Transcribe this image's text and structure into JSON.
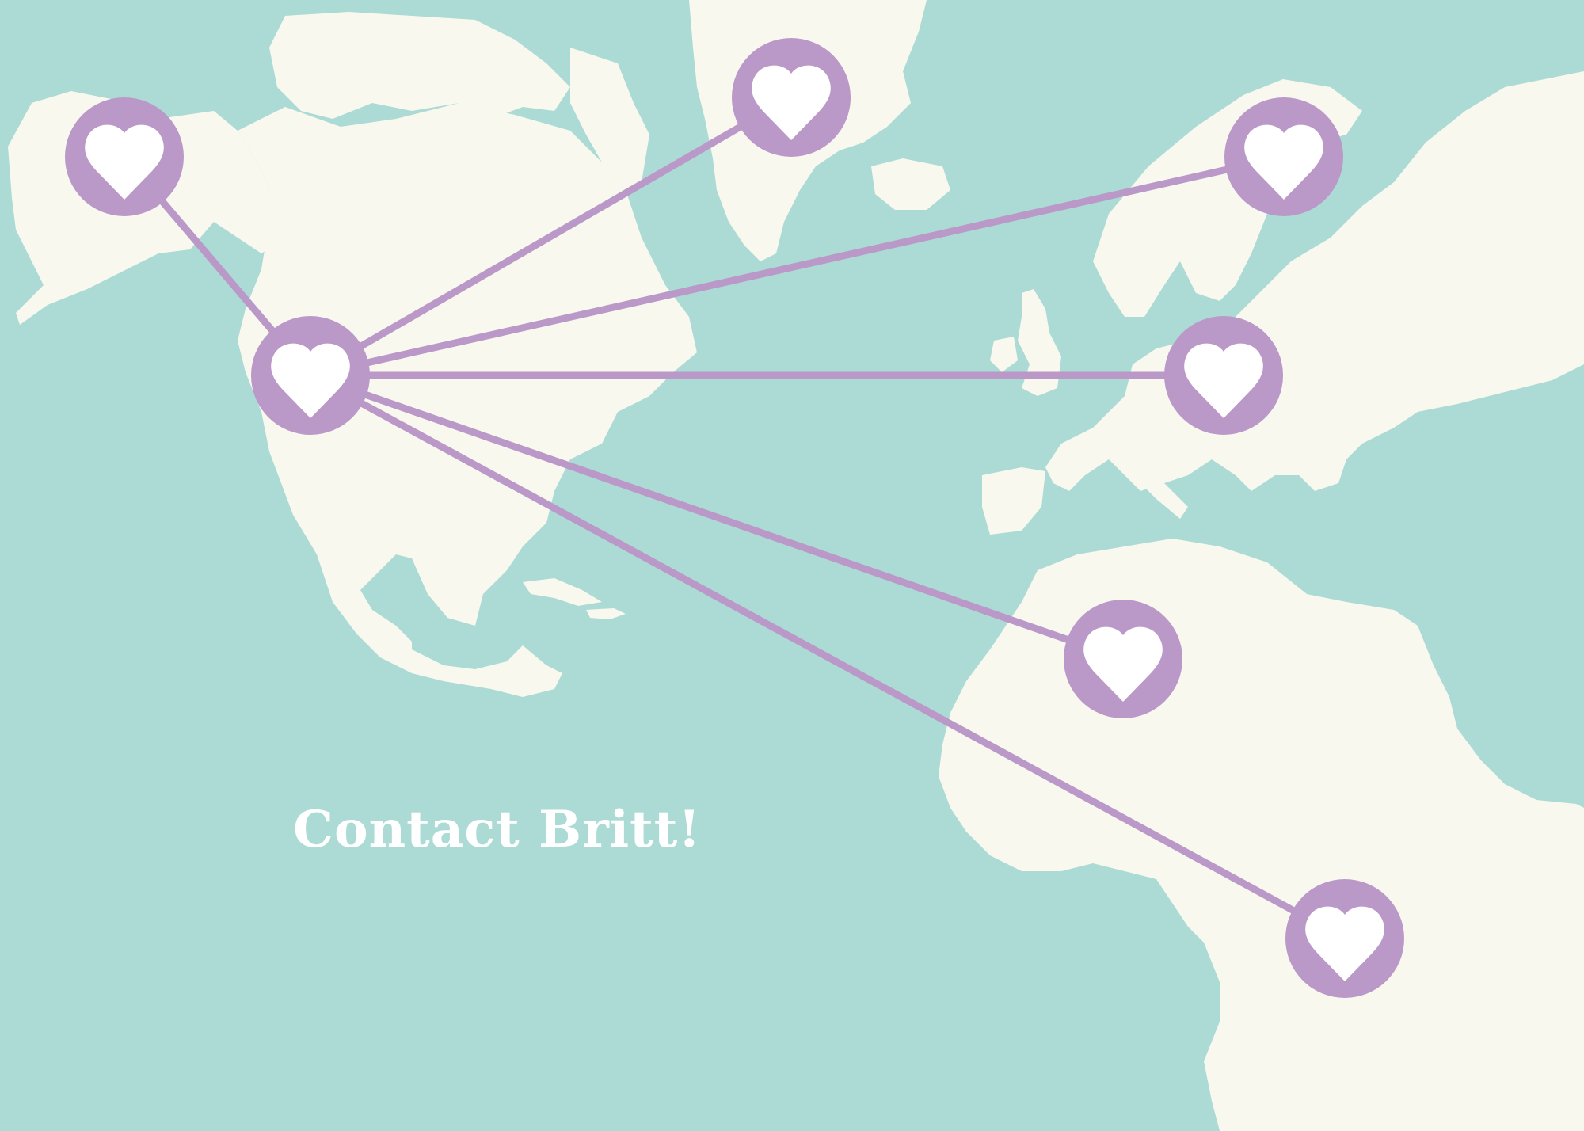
{
  "title": "Contact Britt!",
  "colors": {
    "ocean": "#acdbd5",
    "land": "#f9f8ef",
    "accent": "#ba98c8",
    "heart": "#ffffff"
  },
  "pins": [
    {
      "id": "alaska",
      "icon": "heart-pin-icon"
    },
    {
      "id": "north-america-west-coast",
      "icon": "heart-pin-icon"
    },
    {
      "id": "greenland",
      "icon": "heart-pin-icon"
    },
    {
      "id": "scandinavia",
      "icon": "heart-pin-icon"
    },
    {
      "id": "europe",
      "icon": "heart-pin-icon"
    },
    {
      "id": "west-africa",
      "icon": "heart-pin-icon"
    },
    {
      "id": "central-africa",
      "icon": "heart-pin-icon"
    }
  ],
  "connections": [
    {
      "from": "north-america-west-coast",
      "to": "alaska"
    },
    {
      "from": "north-america-west-coast",
      "to": "greenland"
    },
    {
      "from": "north-america-west-coast",
      "to": "scandinavia"
    },
    {
      "from": "north-america-west-coast",
      "to": "europe"
    },
    {
      "from": "north-america-west-coast",
      "to": "west-africa"
    },
    {
      "from": "north-america-west-coast",
      "to": "central-africa"
    }
  ]
}
